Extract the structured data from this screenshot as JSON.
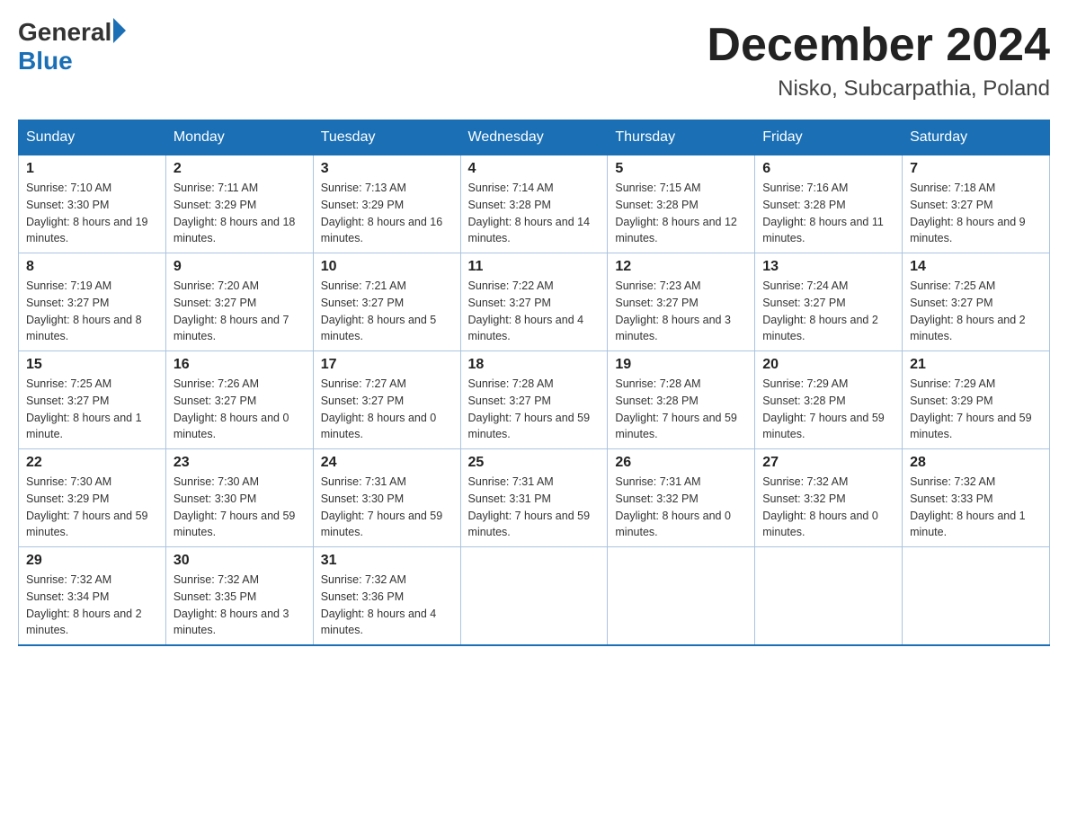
{
  "header": {
    "logo_general": "General",
    "logo_blue": "Blue",
    "month_title": "December 2024",
    "location": "Nisko, Subcarpathia, Poland"
  },
  "days_of_week": [
    "Sunday",
    "Monday",
    "Tuesday",
    "Wednesday",
    "Thursday",
    "Friday",
    "Saturday"
  ],
  "weeks": [
    [
      {
        "day": "1",
        "sunrise": "7:10 AM",
        "sunset": "3:30 PM",
        "daylight": "8 hours and 19 minutes."
      },
      {
        "day": "2",
        "sunrise": "7:11 AM",
        "sunset": "3:29 PM",
        "daylight": "8 hours and 18 minutes."
      },
      {
        "day": "3",
        "sunrise": "7:13 AM",
        "sunset": "3:29 PM",
        "daylight": "8 hours and 16 minutes."
      },
      {
        "day": "4",
        "sunrise": "7:14 AM",
        "sunset": "3:28 PM",
        "daylight": "8 hours and 14 minutes."
      },
      {
        "day": "5",
        "sunrise": "7:15 AM",
        "sunset": "3:28 PM",
        "daylight": "8 hours and 12 minutes."
      },
      {
        "day": "6",
        "sunrise": "7:16 AM",
        "sunset": "3:28 PM",
        "daylight": "8 hours and 11 minutes."
      },
      {
        "day": "7",
        "sunrise": "7:18 AM",
        "sunset": "3:27 PM",
        "daylight": "8 hours and 9 minutes."
      }
    ],
    [
      {
        "day": "8",
        "sunrise": "7:19 AM",
        "sunset": "3:27 PM",
        "daylight": "8 hours and 8 minutes."
      },
      {
        "day": "9",
        "sunrise": "7:20 AM",
        "sunset": "3:27 PM",
        "daylight": "8 hours and 7 minutes."
      },
      {
        "day": "10",
        "sunrise": "7:21 AM",
        "sunset": "3:27 PM",
        "daylight": "8 hours and 5 minutes."
      },
      {
        "day": "11",
        "sunrise": "7:22 AM",
        "sunset": "3:27 PM",
        "daylight": "8 hours and 4 minutes."
      },
      {
        "day": "12",
        "sunrise": "7:23 AM",
        "sunset": "3:27 PM",
        "daylight": "8 hours and 3 minutes."
      },
      {
        "day": "13",
        "sunrise": "7:24 AM",
        "sunset": "3:27 PM",
        "daylight": "8 hours and 2 minutes."
      },
      {
        "day": "14",
        "sunrise": "7:25 AM",
        "sunset": "3:27 PM",
        "daylight": "8 hours and 2 minutes."
      }
    ],
    [
      {
        "day": "15",
        "sunrise": "7:25 AM",
        "sunset": "3:27 PM",
        "daylight": "8 hours and 1 minute."
      },
      {
        "day": "16",
        "sunrise": "7:26 AM",
        "sunset": "3:27 PM",
        "daylight": "8 hours and 0 minutes."
      },
      {
        "day": "17",
        "sunrise": "7:27 AM",
        "sunset": "3:27 PM",
        "daylight": "8 hours and 0 minutes."
      },
      {
        "day": "18",
        "sunrise": "7:28 AM",
        "sunset": "3:27 PM",
        "daylight": "7 hours and 59 minutes."
      },
      {
        "day": "19",
        "sunrise": "7:28 AM",
        "sunset": "3:28 PM",
        "daylight": "7 hours and 59 minutes."
      },
      {
        "day": "20",
        "sunrise": "7:29 AM",
        "sunset": "3:28 PM",
        "daylight": "7 hours and 59 minutes."
      },
      {
        "day": "21",
        "sunrise": "7:29 AM",
        "sunset": "3:29 PM",
        "daylight": "7 hours and 59 minutes."
      }
    ],
    [
      {
        "day": "22",
        "sunrise": "7:30 AM",
        "sunset": "3:29 PM",
        "daylight": "7 hours and 59 minutes."
      },
      {
        "day": "23",
        "sunrise": "7:30 AM",
        "sunset": "3:30 PM",
        "daylight": "7 hours and 59 minutes."
      },
      {
        "day": "24",
        "sunrise": "7:31 AM",
        "sunset": "3:30 PM",
        "daylight": "7 hours and 59 minutes."
      },
      {
        "day": "25",
        "sunrise": "7:31 AM",
        "sunset": "3:31 PM",
        "daylight": "7 hours and 59 minutes."
      },
      {
        "day": "26",
        "sunrise": "7:31 AM",
        "sunset": "3:32 PM",
        "daylight": "8 hours and 0 minutes."
      },
      {
        "day": "27",
        "sunrise": "7:32 AM",
        "sunset": "3:32 PM",
        "daylight": "8 hours and 0 minutes."
      },
      {
        "day": "28",
        "sunrise": "7:32 AM",
        "sunset": "3:33 PM",
        "daylight": "8 hours and 1 minute."
      }
    ],
    [
      {
        "day": "29",
        "sunrise": "7:32 AM",
        "sunset": "3:34 PM",
        "daylight": "8 hours and 2 minutes."
      },
      {
        "day": "30",
        "sunrise": "7:32 AM",
        "sunset": "3:35 PM",
        "daylight": "8 hours and 3 minutes."
      },
      {
        "day": "31",
        "sunrise": "7:32 AM",
        "sunset": "3:36 PM",
        "daylight": "8 hours and 4 minutes."
      },
      null,
      null,
      null,
      null
    ]
  ]
}
